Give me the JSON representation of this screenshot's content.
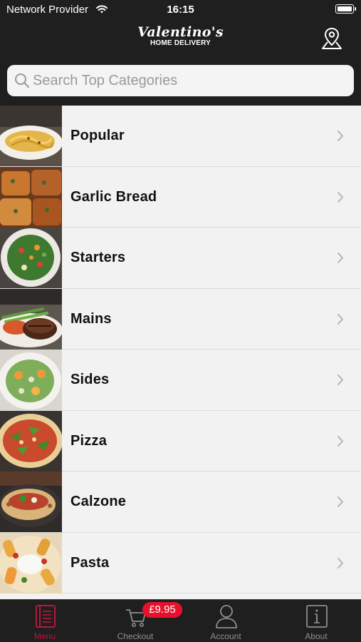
{
  "status_bar": {
    "carrier": "Network Provider",
    "time": "16:15"
  },
  "header": {
    "logo_script": "Valentino's",
    "logo_sub": "HOME DELIVERY",
    "location_icon": "map-pin-icon"
  },
  "search": {
    "placeholder": "Search Top Categories",
    "value": ""
  },
  "categories": [
    {
      "label": "Popular",
      "image": "spaghetti-carbonara"
    },
    {
      "label": "Garlic Bread",
      "image": "garlic-bread"
    },
    {
      "label": "Starters",
      "image": "salad-bowl"
    },
    {
      "label": "Mains",
      "image": "steak"
    },
    {
      "label": "Sides",
      "image": "side-salad"
    },
    {
      "label": "Pizza",
      "image": "rocket-pizza"
    },
    {
      "label": "Calzone",
      "image": "calzone"
    },
    {
      "label": "Pasta",
      "image": "rigatoni-pasta"
    }
  ],
  "tab_bar": {
    "tabs": [
      {
        "label": "Menu",
        "icon": "menu-book-icon",
        "active": true
      },
      {
        "label": "Checkout",
        "icon": "cart-icon",
        "active": false
      },
      {
        "label": "Account",
        "icon": "user-icon",
        "active": false
      },
      {
        "label": "About",
        "icon": "info-icon",
        "active": false
      }
    ],
    "cart_total": "£9.95"
  },
  "colors": {
    "background": "#1f1f1f",
    "list_background": "#f2f2f2",
    "accent": "#b5183b",
    "badge": "#e8112d"
  }
}
